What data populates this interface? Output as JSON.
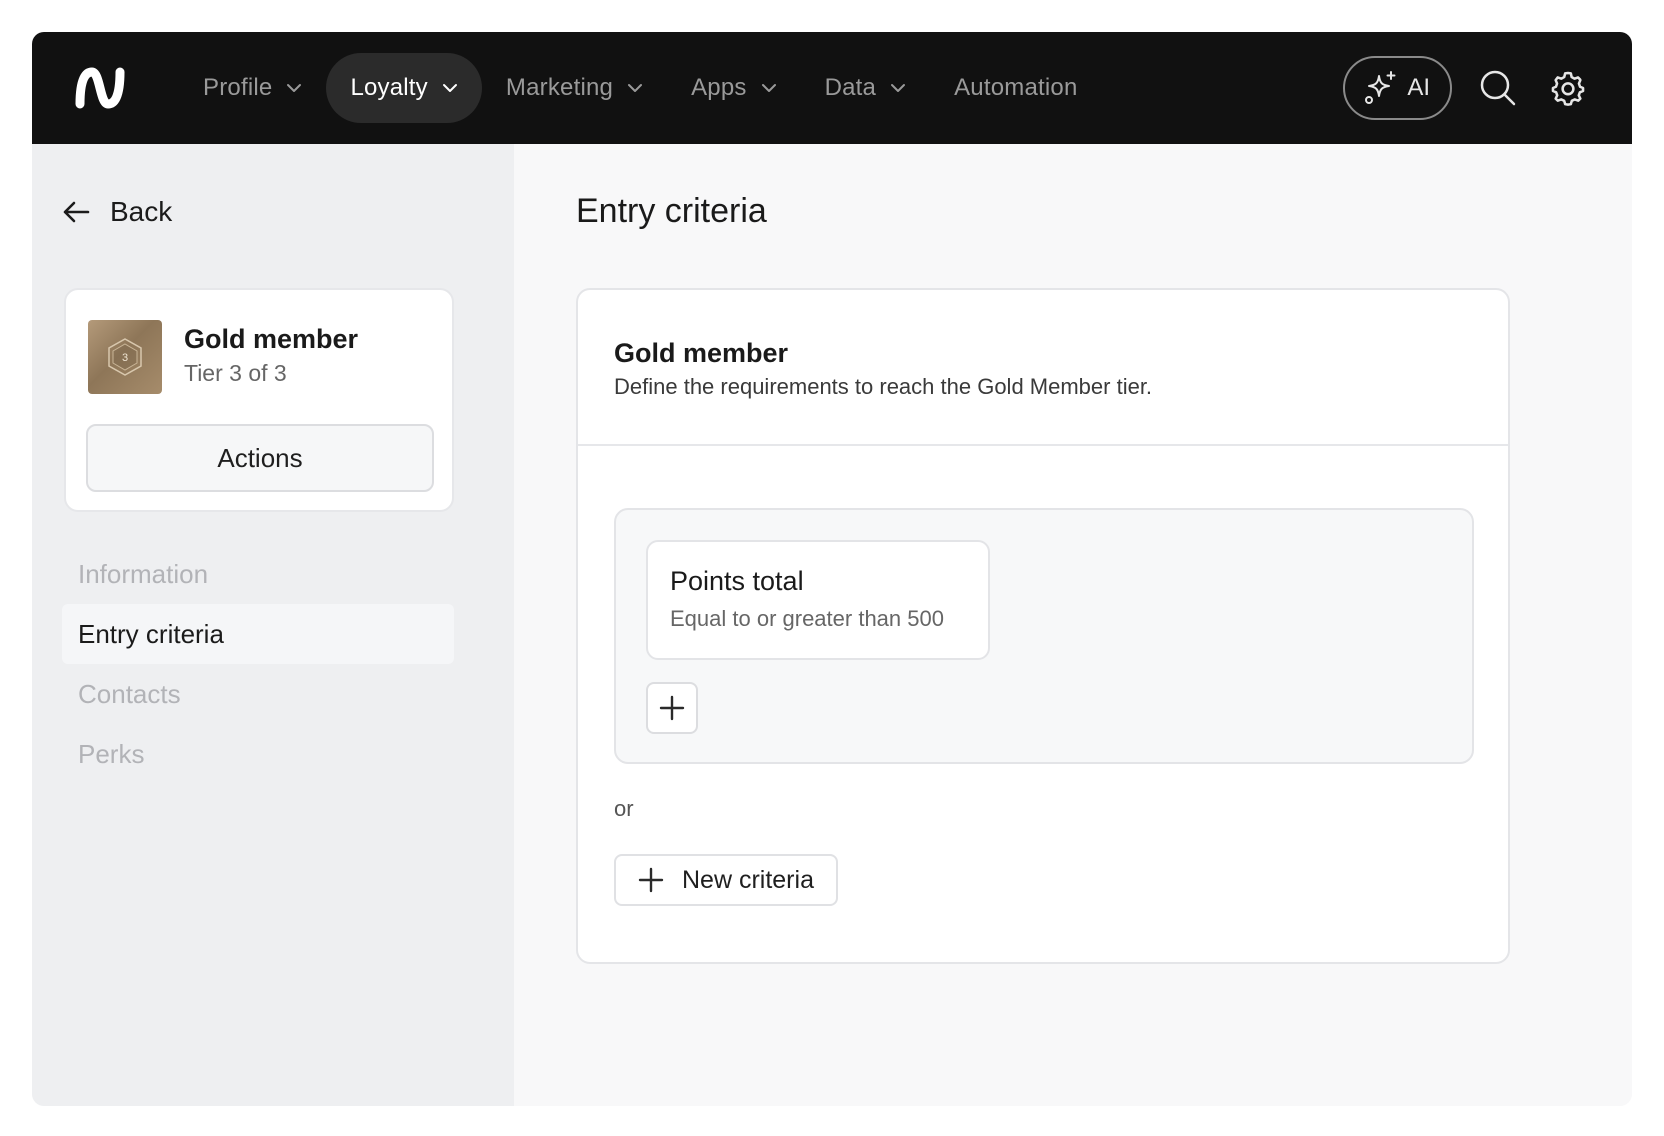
{
  "topbar": {
    "logo_icon": "brand-logo-icon",
    "nav": [
      {
        "label": "Profile",
        "has_dropdown": true,
        "active": false
      },
      {
        "label": "Loyalty",
        "has_dropdown": true,
        "active": true
      },
      {
        "label": "Marketing",
        "has_dropdown": true,
        "active": false
      },
      {
        "label": "Apps",
        "has_dropdown": true,
        "active": false
      },
      {
        "label": "Data",
        "has_dropdown": true,
        "active": false
      },
      {
        "label": "Automation",
        "has_dropdown": false,
        "active": false
      }
    ],
    "ai_label": "AI",
    "icons": [
      "sparkles-icon",
      "search-icon",
      "gear-icon"
    ]
  },
  "sidebar": {
    "back_label": "Back",
    "tier": {
      "badge_number": "3",
      "title": "Gold member",
      "subtitle": "Tier 3 of 3"
    },
    "actions_label": "Actions",
    "menu": [
      {
        "label": "Information",
        "active": false
      },
      {
        "label": "Entry criteria",
        "active": true
      },
      {
        "label": "Contacts",
        "active": false
      },
      {
        "label": "Perks",
        "active": false
      }
    ]
  },
  "main": {
    "page_title": "Entry criteria",
    "panel": {
      "title": "Gold member",
      "description": "Define the requirements to reach the Gold Member tier.",
      "criteria": [
        {
          "name": "Points total",
          "condition": "Equal to or greater than 500"
        }
      ],
      "or_label": "or",
      "new_criteria_label": "New criteria"
    }
  },
  "colors": {
    "topbar_bg": "#111111",
    "sidebar_bg": "#eeeff1",
    "main_bg": "#f8f8f9",
    "active_nav_bg": "#2b2b2b"
  }
}
